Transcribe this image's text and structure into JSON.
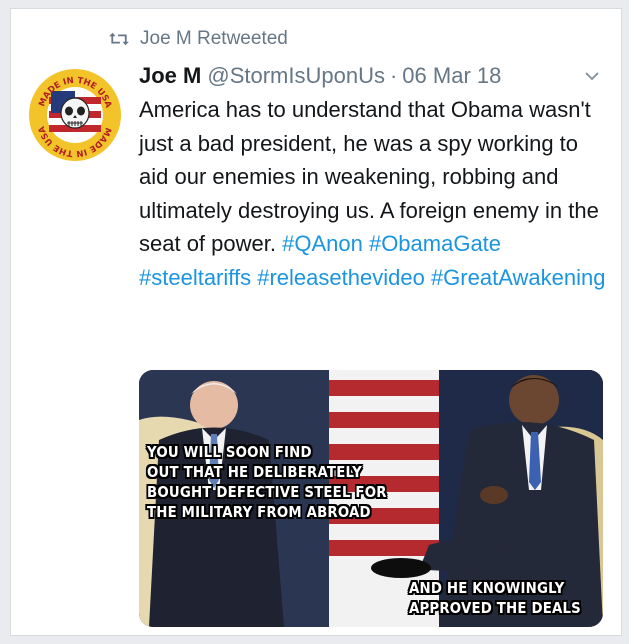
{
  "retweet": {
    "label": "Joe M Retweeted",
    "icon": "retweet-icon"
  },
  "tweet": {
    "name": "Joe M",
    "handle": "@StormIsUponUs",
    "separator": "·",
    "date": "06 Mar 18",
    "text_parts": [
      "America has to understand that Obama wasn't just a bad president, he was a spy working to aid our enemies in weakening, robbing and ultimately destroying us. A foreign enemy in the seat of power. "
    ],
    "hashtags": [
      "#QAnon",
      "#ObamaGate",
      "#steeltariffs",
      "#releasethevideo",
      "#GreatAwakening"
    ],
    "avatar_text": [
      "MADE IN THE USA",
      "MADE IN THE USA"
    ]
  },
  "media": {
    "caption_top": [
      "YOU WILL SOON FIND",
      "OUT THAT HE DELIBERATELY",
      "BOUGHT DEFECTIVE STEEL FOR",
      "THE MILITARY FROM ABROAD"
    ],
    "caption_bottom": [
      "AND HE KNOWINGLY",
      "APPROVED THE DEALS"
    ]
  },
  "colors": {
    "hashtag": "#1b95e0",
    "text": "#14171a",
    "muted": "#657786"
  }
}
